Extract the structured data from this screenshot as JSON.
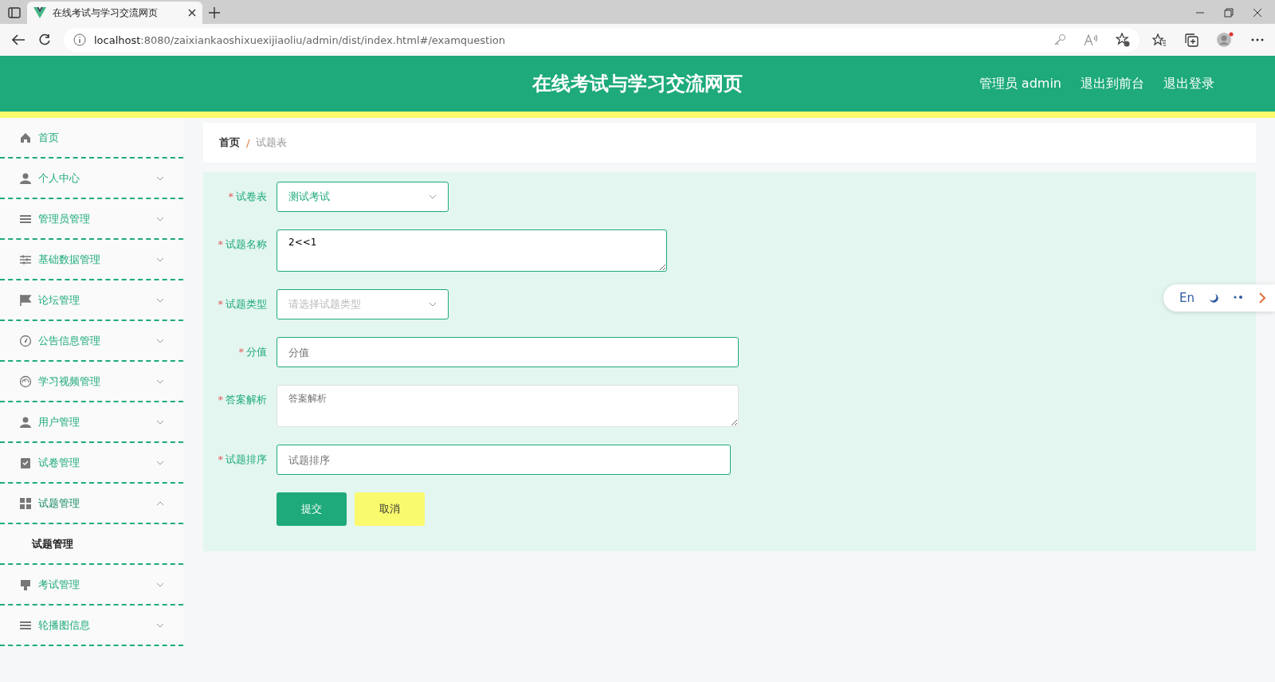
{
  "browser": {
    "tab_title": "在线考试与学习交流网页",
    "url_host": "localhost",
    "url_path": ":8080/zaixiankaoshixuexijiaoliu/admin/dist/index.html#/examquestion"
  },
  "header": {
    "title": "在线考试与学习交流网页",
    "user": "管理员 admin",
    "links": [
      "退出到前台",
      "退出登录"
    ]
  },
  "sidebar": {
    "items": [
      {
        "label": "首页",
        "kind": "link"
      },
      {
        "label": "个人中心",
        "kind": "menu",
        "expanded": false
      },
      {
        "label": "管理员管理",
        "kind": "menu",
        "expanded": false
      },
      {
        "label": "基础数据管理",
        "kind": "menu",
        "expanded": false
      },
      {
        "label": "论坛管理",
        "kind": "menu",
        "expanded": false
      },
      {
        "label": "公告信息管理",
        "kind": "menu",
        "expanded": false
      },
      {
        "label": "学习视频管理",
        "kind": "menu",
        "expanded": false
      },
      {
        "label": "用户管理",
        "kind": "menu",
        "expanded": false
      },
      {
        "label": "试卷管理",
        "kind": "menu",
        "expanded": false
      },
      {
        "label": "试题管理",
        "kind": "menu",
        "expanded": true,
        "children": [
          {
            "label": "试题管理",
            "selected": true
          }
        ]
      },
      {
        "label": "考试管理",
        "kind": "menu",
        "expanded": false
      },
      {
        "label": "轮播图信息",
        "kind": "menu",
        "expanded": false
      }
    ]
  },
  "breadcrumb": {
    "items": [
      "首页",
      "试题表"
    ],
    "separator": "/"
  },
  "form": {
    "fields": [
      {
        "kind": "select",
        "label": "试卷表",
        "required_mark": "*",
        "value": "测试考试"
      },
      {
        "kind": "textarea",
        "label": "试题名称",
        "required_mark": "*",
        "value": "2<<1"
      },
      {
        "kind": "select",
        "label": "试题类型",
        "required_mark": "*",
        "placeholder": "请选择试题类型"
      },
      {
        "kind": "input",
        "label": "分值",
        "required_mark": "*",
        "placeholder": "分值"
      },
      {
        "kind": "textarea",
        "label": "答案解析",
        "required_mark": "*",
        "placeholder": "答案解析"
      },
      {
        "kind": "input",
        "label": "试题排序",
        "required_mark": "*",
        "placeholder": "试题排序"
      }
    ],
    "buttons": [
      {
        "kind": "primary",
        "label": "提交"
      },
      {
        "kind": "secondary",
        "label": "取消"
      }
    ]
  },
  "widget": {
    "language": "En"
  }
}
